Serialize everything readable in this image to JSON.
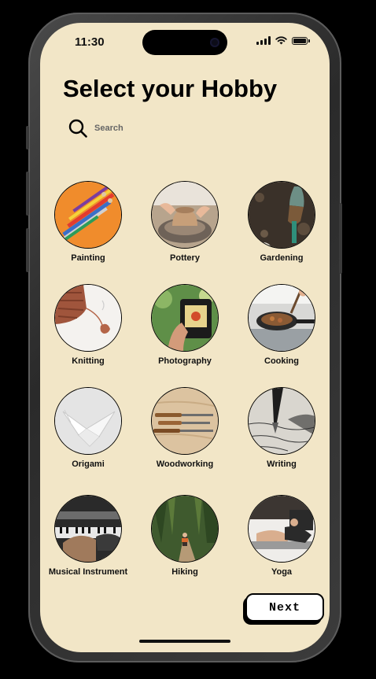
{
  "status_bar": {
    "time": "11:30",
    "icons": [
      "cellular-signal-icon",
      "wifi-icon",
      "battery-icon"
    ]
  },
  "page": {
    "title": "Select your Hobby"
  },
  "search": {
    "placeholder": "Search",
    "value": "",
    "icon": "search-icon"
  },
  "hobbies": [
    {
      "label": "Painting",
      "image": "paintbrushes-photo"
    },
    {
      "label": "Pottery",
      "image": "pottery-wheel-photo"
    },
    {
      "label": "Gardening",
      "image": "garden-trowel-photo"
    },
    {
      "label": "Knitting",
      "image": "knitted-yarn-photo"
    },
    {
      "label": "Photography",
      "image": "camera-photo"
    },
    {
      "label": "Cooking",
      "image": "frying-pan-photo"
    },
    {
      "label": "Origami",
      "image": "paper-crane-photo"
    },
    {
      "label": "Woodworking",
      "image": "carving-tools-photo"
    },
    {
      "label": "Writing",
      "image": "fountain-pen-photo"
    },
    {
      "label": "Musical Instrument",
      "image": "piano-keys-photo"
    },
    {
      "label": "Hiking",
      "image": "forest-trail-photo"
    },
    {
      "label": "Yoga",
      "image": "yoga-pose-photo"
    }
  ],
  "footer": {
    "next_label": "Next"
  },
  "colors": {
    "background": "#f2e6c7",
    "text": "#000000",
    "button_bg": "#ffffff",
    "frame": "#3a3a3a"
  }
}
